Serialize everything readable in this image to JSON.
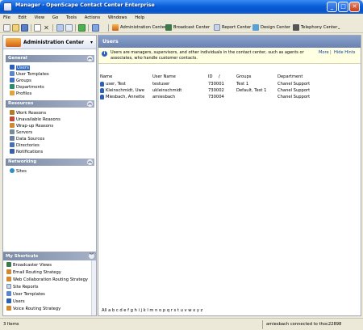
{
  "window": {
    "title": "Manager - OpenScape Contact Center Enterprise",
    "controls": {
      "minimize": "_",
      "maximize": "□",
      "close": "✕"
    }
  },
  "menu": [
    "File",
    "Edit",
    "View",
    "Go",
    "Tools",
    "Actions",
    "Windows",
    "Help"
  ],
  "toolbar": {
    "admin_center": "Administration Center",
    "broadcast_center": "Broadcast Center",
    "report_center": "Report Center",
    "design_center": "Design Center",
    "telephony_center": "Telephony Center"
  },
  "sidebar": {
    "header": "Administration Center",
    "sections": [
      {
        "title": "General",
        "items": [
          "Users",
          "User Templates",
          "Groups",
          "Departments",
          "Profiles"
        ]
      },
      {
        "title": "Resources",
        "items": [
          "Work Reasons",
          "Unavailable Reasons",
          "Wrap-up Reasons",
          "Servers",
          "Data Sources",
          "Directories",
          "Notifications"
        ]
      },
      {
        "title": "Networking",
        "items": [
          "Sites"
        ]
      }
    ]
  },
  "shortcuts": {
    "title": "My Shortcuts",
    "items": [
      "Broadcaster Views",
      "Email Routing Strategy",
      "Web Collaboration Routing Strategy",
      "Site Reports",
      "User Templates",
      "Users",
      "Voice Routing Strategy"
    ]
  },
  "main": {
    "title": "Users",
    "hint": "Users are managers, supervisors, and other individuals in the contact center, such as agents or associates, who handle customer contacts.",
    "more": "More",
    "hide_hints": "Hide Hints",
    "columns": [
      "Name",
      "User Name",
      "ID",
      "Groups",
      "Department"
    ],
    "rows": [
      {
        "name": "user, Test",
        "username": "testuser",
        "id": "730001",
        "groups": "Test 1",
        "department": "Chanel Support"
      },
      {
        "name": "Kleinschmidt, Uwe",
        "username": "ukleinschmidt",
        "id": "730002",
        "groups": "Default, Test 1",
        "department": "Chanel Support"
      },
      {
        "name": "Miesbach, Annette",
        "username": "amiesbach",
        "id": "730004",
        "groups": "",
        "department": "Chanel Support"
      }
    ],
    "alphabet": "All  a  b  c  d  e  f  g  h  i  j  k  l  m  n  o  p  q  r  s  t  u  v  w  x  y  z"
  },
  "status": {
    "items": "3 Items",
    "connection": "amiesbach connected to thoc22898"
  }
}
